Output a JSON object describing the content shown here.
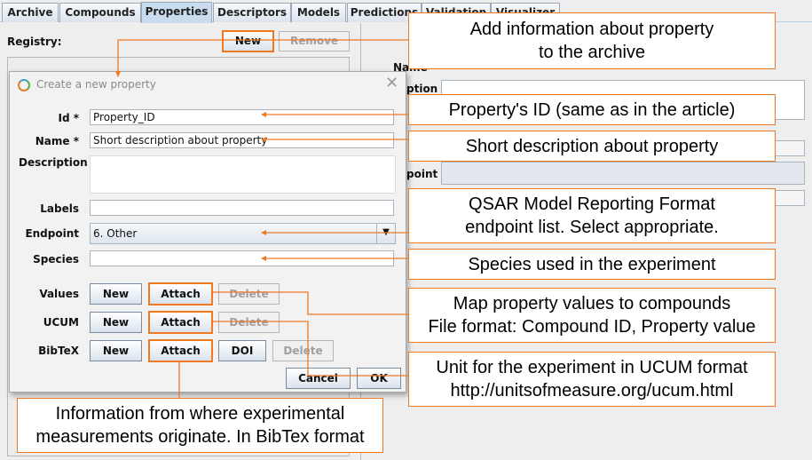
{
  "tabs": [
    "Archive",
    "Compounds",
    "Properties",
    "Descriptors",
    "Models",
    "Predictions",
    "Validation",
    "Visualizer"
  ],
  "active_tab": "Properties",
  "registry": {
    "label": "Registry:",
    "new_label": "New",
    "remove_label": "Remove"
  },
  "right_labels": {
    "name": "Name",
    "description": "ption",
    "endpoint": "point"
  },
  "dialog": {
    "title": "Create a new property",
    "fields": {
      "id_label": "Id *",
      "id_value": "Property_ID",
      "name_label": "Name *",
      "name_value": "Short description about property",
      "description_label": "Description",
      "labels_label": "Labels",
      "endpoint_label": "Endpoint",
      "endpoint_value": "6. Other",
      "species_label": "Species"
    },
    "rows": {
      "values_label": "Values",
      "ucum_label": "UCUM",
      "bibtex_label": "BibTeX",
      "new": "New",
      "attach": "Attach",
      "delete": "Delete",
      "doi": "DOI"
    },
    "cancel_label": "Cancel",
    "ok_label": "OK"
  },
  "callouts": {
    "archive": [
      "Add information about property",
      "to the archive"
    ],
    "id": [
      "Property's ID (same as in the article)"
    ],
    "name": [
      "Short description about property"
    ],
    "endpoint": [
      "QSAR Model Reporting Format",
      "endpoint list. Select appropriate."
    ],
    "species": [
      "Species used in the experiment"
    ],
    "values": [
      "Map property values to compounds",
      "File format: Compound ID, Property value"
    ],
    "ucum": [
      "Unit for the experiment in UCUM format",
      "http://unitsofmeasure.org/ucum.html"
    ],
    "bibtex": [
      "Information from where experimental",
      "measurements originate. In BibTex format"
    ]
  },
  "colors": {
    "accent": "#f07820",
    "button_top": "#ffffff",
    "button_bottom": "#d9e3ee",
    "tab_active": "#c9dbef"
  }
}
